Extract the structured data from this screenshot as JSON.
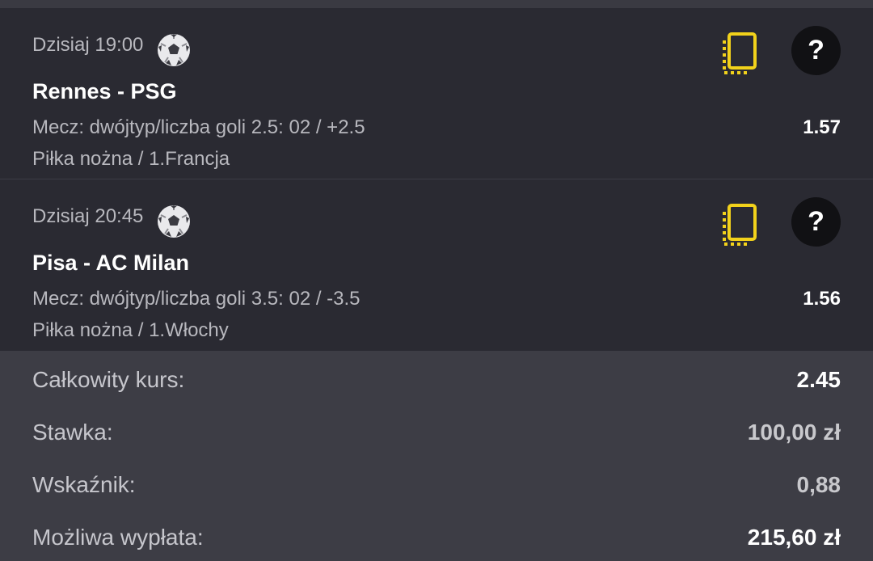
{
  "bets": [
    {
      "time": "Dzisiaj 19:00",
      "sport_icon": "soccer-ball-icon",
      "match": "Rennes - PSG",
      "market": "Mecz: dwójtyp/liczba goli 2.5: 02 / +2.5",
      "odd": "1.57",
      "league": "Piłka nożna / 1.Francja",
      "copy_icon": "copy-icon",
      "help_label": "?"
    },
    {
      "time": "Dzisiaj 20:45",
      "sport_icon": "soccer-ball-icon",
      "match": "Pisa - AC Milan",
      "market": "Mecz: dwójtyp/liczba goli 3.5: 02 / -3.5",
      "odd": "1.56",
      "league": "Piłka nożna / 1.Włochy",
      "copy_icon": "copy-icon",
      "help_label": "?"
    }
  ],
  "summary": {
    "total_odds_label": "Całkowity kurs:",
    "total_odds_value": "2.45",
    "stake_label": "Stawka:",
    "stake_value": "100,00 zł",
    "indicator_label": "Wskaźnik:",
    "indicator_value": "0,88",
    "payout_label": "Możliwa wypłata:",
    "payout_value": "215,60 zł"
  },
  "colors": {
    "background": "#2a2a32",
    "summary_background": "#3d3d45",
    "accent_yellow": "#f2d21b",
    "help_button": "#111114"
  }
}
